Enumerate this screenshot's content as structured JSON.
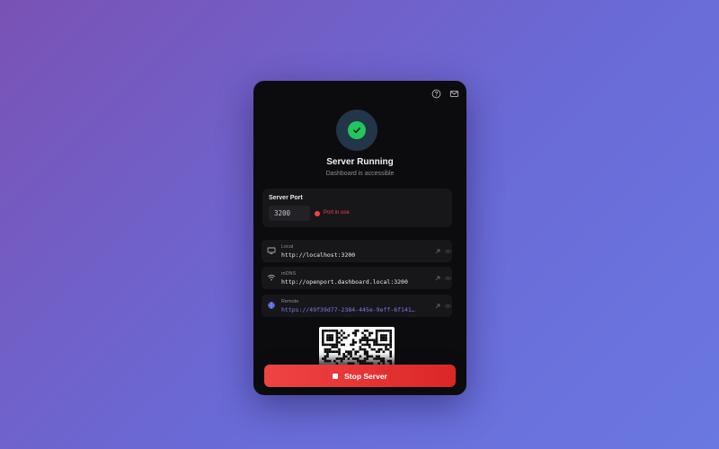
{
  "header": {
    "help_icon": "help-circle-icon",
    "mail_icon": "mail-icon"
  },
  "status": {
    "icon": "check-icon",
    "title": "Server Running",
    "subtitle": "Dashboard is accessible",
    "accent": "#22c55e"
  },
  "port": {
    "label": "Server Port",
    "value": "3200",
    "status_text": "Port in use",
    "status_color": "#ef4444"
  },
  "urls": [
    {
      "label": "Local",
      "value": "http://localhost:3200",
      "icon": "monitor-icon"
    },
    {
      "label": "mDNS",
      "value": "http://openport.dashboard.local:3200",
      "icon": "wifi-icon"
    },
    {
      "label": "Remote",
      "value": "https://49f39d77-2384-445e-9eff-6f1417…",
      "icon": "globe-icon"
    }
  ],
  "actions": {
    "stop_label": "Stop Server",
    "stop_color": "#ef4444"
  }
}
